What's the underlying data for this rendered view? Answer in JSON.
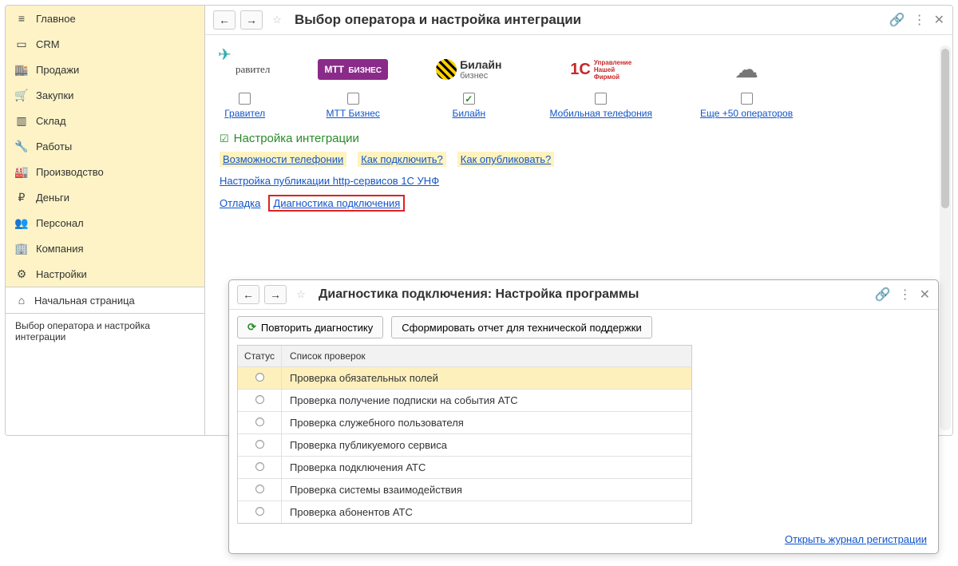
{
  "sidebar": {
    "items": [
      {
        "label": "Главное",
        "icon": "menu-icon"
      },
      {
        "label": "CRM",
        "icon": "card-icon"
      },
      {
        "label": "Продажи",
        "icon": "store-icon"
      },
      {
        "label": "Закупки",
        "icon": "cart-icon"
      },
      {
        "label": "Склад",
        "icon": "warehouse-icon"
      },
      {
        "label": "Работы",
        "icon": "wrench-icon"
      },
      {
        "label": "Производство",
        "icon": "factory-icon"
      },
      {
        "label": "Деньги",
        "icon": "money-icon"
      },
      {
        "label": "Персонал",
        "icon": "people-icon"
      },
      {
        "label": "Компания",
        "icon": "building-icon"
      },
      {
        "label": "Настройки",
        "icon": "gear-icon"
      }
    ],
    "home": "Начальная страница",
    "current_tab": "Выбор оператора и настройка интеграции"
  },
  "header": {
    "title": "Выбор оператора и настройка интеграции"
  },
  "operators": [
    {
      "name": "Гравител",
      "checked": false
    },
    {
      "name": "МТТ Бизнес",
      "checked": false
    },
    {
      "name": "Билайн",
      "checked": true
    },
    {
      "name": "Мобильная телефония",
      "checked": false
    },
    {
      "name": "Еще +50 операторов",
      "checked": false
    }
  ],
  "section_title": "Настройка интеграции",
  "highlight_links": [
    "Возможности телефонии",
    "Как подключить?",
    "Как опубликовать?"
  ],
  "link_http": "Настройка публикации http-сервисов 1С УНФ",
  "link_debug": "Отладка",
  "link_diag": "Диагностика подключения",
  "modal": {
    "title": "Диагностика подключения: Настройка программы",
    "btn_repeat": "Повторить диагностику",
    "btn_report": "Сформировать отчет для технической поддержки",
    "col_status": "Статус",
    "col_checks": "Список проверок",
    "rows": [
      "Проверка обязательных полей",
      "Проверка получение подписки на события АТС",
      "Проверка служебного пользователя",
      "Проверка публикуемого сервиса",
      "Проверка подключения АТС",
      "Проверка системы взаимодействия",
      "Проверка абонентов АТС"
    ],
    "log_link": "Открыть журнал регистрации"
  },
  "logo_text": {
    "gravitel": "равител",
    "mtt": "МТТ",
    "mtt_sub": "БИЗНЕС",
    "beeline1": "Билайн",
    "beeline2": "бизнес",
    "oneC": "1C",
    "oneC_tag": "Управление\nНашей\nФирмой"
  }
}
